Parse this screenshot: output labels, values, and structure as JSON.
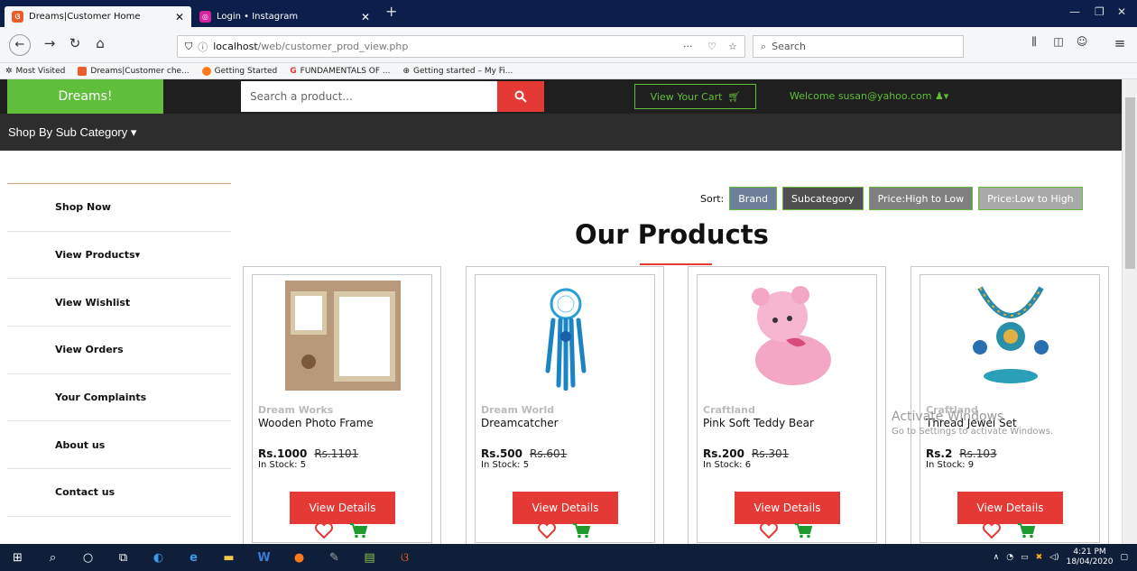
{
  "browser": {
    "tabs": [
      {
        "label": "Dreams|Customer Home",
        "icon": "dreams-favicon",
        "active": true
      },
      {
        "label": "Login • Instagram",
        "icon": "instagram-favicon",
        "active": false
      }
    ],
    "url_host": "localhost",
    "url_path": "/web/customer_prod_view.php",
    "search_placeholder": "Search",
    "url_menu": "···",
    "bookmarks": [
      {
        "label": "Most Visited",
        "icon": "gear-icon"
      },
      {
        "label": "Dreams|Customer che...",
        "icon": "dreams-favicon"
      },
      {
        "label": "Getting Started",
        "icon": "firefox-icon"
      },
      {
        "label": "FUNDAMENTALS OF ...",
        "icon": "google-icon"
      },
      {
        "label": "Getting started – My Fi...",
        "icon": "globe-icon"
      }
    ],
    "accent_color": "#0b1f4a"
  },
  "site": {
    "logo": "Dreams!",
    "search_placeholder": "Search a product...",
    "cart_label": "View Your Cart",
    "welcome_label": "Welcome  susan@yahoo.com",
    "subcategory_label": "Shop By Sub Category",
    "brand_color": "#5fbf3a",
    "accent_red": "#e53935",
    "sidebar": [
      "Shop Now",
      "View Products",
      "View Wishlist",
      "View Orders",
      "Your Complaints",
      "About us",
      "Contact us"
    ],
    "sort_label": "Sort:",
    "sort_buttons": [
      {
        "label": "Brand",
        "color": "#6d7f99"
      },
      {
        "label": "Subcategory",
        "color": "#4f4f4f"
      },
      {
        "label": "Price:High to Low",
        "color": "#808080"
      },
      {
        "label": "Price:Low to High",
        "color": "#a9a9a9"
      }
    ],
    "heading": "Our Products",
    "view_details_label": "View Details",
    "products": [
      {
        "brand": "Dream Works",
        "name": "Wooden Photo Frame",
        "price": "Rs.1000",
        "old_price": "Rs.1101",
        "stock": "In Stock: 5",
        "image": "photo-frame"
      },
      {
        "brand": "Dream World",
        "name": "Dreamcatcher",
        "price": "Rs.500",
        "old_price": "Rs.601",
        "stock": "In Stock: 5",
        "image": "dreamcatcher"
      },
      {
        "brand": "Craftland",
        "name": "Pink Soft Teddy Bear",
        "price": "Rs.200",
        "old_price": "Rs.301",
        "stock": "In Stock: 6",
        "image": "teddy-bear"
      },
      {
        "brand": "Craftland",
        "name": "Thread Jewel Set",
        "price": "Rs.2",
        "old_price": "Rs.103",
        "stock": "In Stock: 9",
        "image": "jewel-set"
      }
    ]
  },
  "watermark": {
    "line1": "Activate Windows",
    "line2": "Go to Settings to activate Windows."
  },
  "taskbar": {
    "time": "4:21 PM",
    "date": "18/04/2020"
  }
}
